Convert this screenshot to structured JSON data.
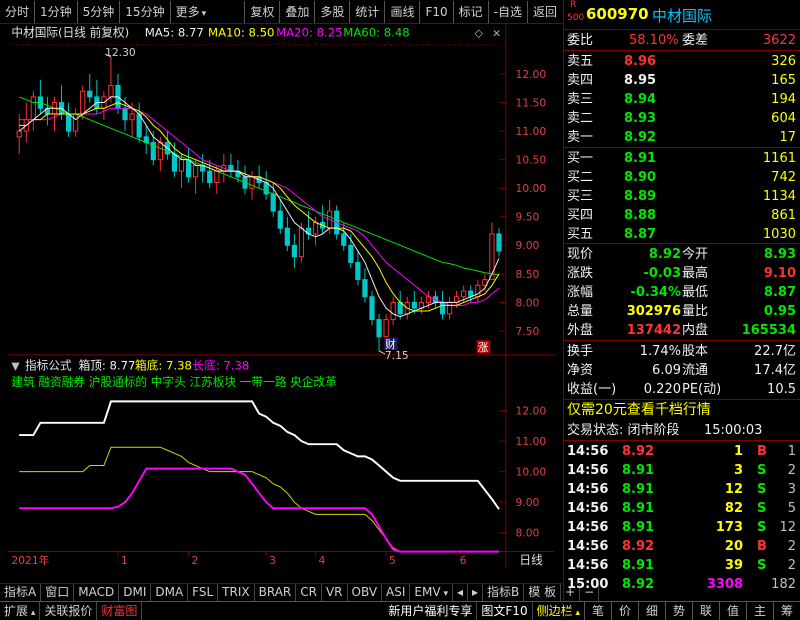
{
  "toolbar": {
    "left": [
      "分时",
      "1分钟",
      "5分钟",
      "15分钟",
      "更多"
    ],
    "right": [
      "复权",
      "叠加",
      "多股",
      "统计",
      "画线",
      "F10",
      "标记",
      "-自选",
      "返回"
    ]
  },
  "chart_header": {
    "title": "中材国际(日线 前复权)",
    "ma5": "MA5: 8.77",
    "ma10": "MA10: 8.50",
    "ma20": "MA20: 8.25",
    "ma60": "MA60: 8.48",
    "high_mark": "12.30",
    "low_mark": "7.15",
    "cai_label": "财",
    "zhang_label": "涨"
  },
  "indicator": {
    "title": "指标公式",
    "top": "箱顶: 8.77",
    "bottom": "箱底: 7.38",
    "long_bottom": "长底: 7.38",
    "concepts": "建筑 融资融券 沪股通标的 中字头 江苏板块 一带一路 央企改革"
  },
  "chart_data": [
    {
      "type": "candlestick",
      "title": "中材国际(日线 前复权)",
      "y_ticks": [
        "12.00",
        "11.50",
        "11.00",
        "10.50",
        "10.00",
        "9.50",
        "9.00",
        "8.50",
        "8.00",
        "7.50"
      ],
      "ylim": [
        7.15,
        12.45
      ],
      "x_ticks": [
        "2021年",
        "1",
        "2",
        "3",
        "4",
        "5",
        "6"
      ],
      "x_last": "日线",
      "series_names": [
        "MA5",
        "MA10",
        "MA20",
        "MA60"
      ],
      "candles": [
        [
          10.9,
          11.3,
          10.6,
          11.0
        ],
        [
          11.0,
          11.5,
          10.8,
          11.2
        ],
        [
          11.2,
          11.7,
          11.0,
          11.6
        ],
        [
          11.6,
          11.9,
          11.3,
          11.4
        ],
        [
          11.4,
          11.6,
          11.1,
          11.3
        ],
        [
          11.3,
          11.6,
          11.0,
          11.5
        ],
        [
          11.5,
          11.8,
          11.2,
          11.3
        ],
        [
          11.3,
          11.5,
          10.9,
          11.0
        ],
        [
          11.0,
          11.4,
          10.9,
          11.3
        ],
        [
          11.3,
          11.8,
          11.2,
          11.7
        ],
        [
          11.7,
          12.0,
          11.5,
          11.6
        ],
        [
          11.6,
          11.9,
          11.3,
          11.4
        ],
        [
          11.4,
          11.7,
          11.2,
          11.6
        ],
        [
          11.6,
          12.3,
          11.5,
          11.8
        ],
        [
          11.8,
          12.0,
          11.3,
          11.4
        ],
        [
          11.4,
          11.6,
          11.0,
          11.2
        ],
        [
          11.2,
          11.5,
          10.9,
          11.3
        ],
        [
          11.3,
          11.5,
          10.8,
          10.9
        ],
        [
          10.9,
          11.1,
          10.6,
          10.8
        ],
        [
          10.8,
          11.0,
          10.4,
          10.5
        ],
        [
          10.5,
          10.9,
          10.3,
          10.8
        ],
        [
          10.8,
          11.0,
          10.5,
          10.6
        ],
        [
          10.6,
          10.8,
          10.2,
          10.3
        ],
        [
          10.3,
          10.6,
          10.0,
          10.5
        ],
        [
          10.5,
          10.7,
          10.1,
          10.2
        ],
        [
          10.2,
          10.5,
          9.9,
          10.4
        ],
        [
          10.4,
          10.6,
          10.1,
          10.3
        ],
        [
          10.3,
          10.5,
          10.0,
          10.1
        ],
        [
          10.1,
          10.4,
          9.9,
          10.3
        ],
        [
          10.3,
          10.6,
          10.1,
          10.4
        ],
        [
          10.4,
          10.6,
          10.2,
          10.3
        ],
        [
          10.3,
          10.5,
          10.1,
          10.2
        ],
        [
          10.2,
          10.4,
          9.9,
          10.0
        ],
        [
          10.0,
          10.3,
          9.8,
          10.2
        ],
        [
          10.2,
          10.4,
          10.0,
          10.1
        ],
        [
          10.1,
          10.3,
          9.8,
          9.9
        ],
        [
          9.9,
          10.1,
          9.5,
          9.6
        ],
        [
          9.6,
          9.8,
          9.2,
          9.3
        ],
        [
          9.3,
          9.5,
          8.9,
          9.0
        ],
        [
          9.0,
          9.2,
          8.6,
          8.8
        ],
        [
          8.8,
          9.4,
          8.7,
          9.3
        ],
        [
          9.3,
          9.6,
          9.1,
          9.2
        ],
        [
          9.2,
          9.5,
          9.0,
          9.4
        ],
        [
          9.4,
          9.7,
          9.2,
          9.3
        ],
        [
          9.3,
          9.8,
          9.2,
          9.6
        ],
        [
          9.6,
          9.7,
          9.1,
          9.2
        ],
        [
          9.2,
          9.4,
          8.9,
          9.0
        ],
        [
          9.0,
          9.2,
          8.6,
          8.7
        ],
        [
          8.7,
          8.9,
          8.3,
          8.4
        ],
        [
          8.4,
          8.6,
          8.0,
          8.1
        ],
        [
          8.1,
          8.2,
          7.6,
          7.7
        ],
        [
          7.7,
          7.8,
          7.15,
          7.4
        ],
        [
          7.4,
          7.8,
          7.3,
          7.7
        ],
        [
          7.7,
          8.1,
          7.6,
          8.0
        ],
        [
          8.0,
          8.2,
          7.7,
          7.8
        ],
        [
          7.8,
          8.1,
          7.7,
          8.0
        ],
        [
          8.0,
          8.2,
          7.8,
          7.9
        ],
        [
          7.9,
          8.1,
          7.8,
          8.0
        ],
        [
          8.0,
          8.2,
          7.9,
          8.1
        ],
        [
          8.1,
          8.2,
          7.9,
          8.0
        ],
        [
          8.0,
          8.2,
          7.7,
          7.8
        ],
        [
          7.8,
          8.1,
          7.7,
          8.0
        ],
        [
          8.0,
          8.2,
          7.9,
          8.1
        ],
        [
          8.1,
          8.3,
          8.0,
          8.2
        ],
        [
          8.2,
          8.3,
          8.0,
          8.1
        ],
        [
          8.1,
          8.4,
          8.0,
          8.3
        ],
        [
          8.3,
          8.5,
          8.2,
          8.4
        ],
        [
          8.4,
          9.4,
          8.4,
          9.2
        ],
        [
          9.2,
          9.3,
          8.8,
          8.9
        ]
      ],
      "ma5": [
        11.0,
        11.1,
        11.2,
        11.3,
        11.4,
        11.4,
        11.4,
        11.3,
        11.2,
        11.3,
        11.4,
        11.5,
        11.5,
        11.6,
        11.6,
        11.5,
        11.4,
        11.3,
        11.1,
        10.9,
        10.8,
        10.7,
        10.6,
        10.5,
        10.5,
        10.4,
        10.4,
        10.35,
        10.3,
        10.3,
        10.3,
        10.3,
        10.2,
        10.2,
        10.15,
        10.1,
        10.0,
        9.8,
        9.6,
        9.4,
        9.3,
        9.2,
        9.15,
        9.2,
        9.3,
        9.3,
        9.25,
        9.1,
        8.9,
        8.7,
        8.4,
        8.1,
        7.9,
        7.8,
        7.75,
        7.8,
        7.85,
        7.9,
        7.95,
        8.0,
        8.0,
        8.0,
        8.0,
        8.05,
        8.1,
        8.15,
        8.25,
        8.5,
        8.77
      ],
      "ma10": [
        11.1,
        11.1,
        11.2,
        11.2,
        11.3,
        11.3,
        11.3,
        11.3,
        11.3,
        11.3,
        11.35,
        11.4,
        11.4,
        11.45,
        11.5,
        11.45,
        11.4,
        11.35,
        11.25,
        11.1,
        11.0,
        10.85,
        10.7,
        10.6,
        10.55,
        10.5,
        10.45,
        10.4,
        10.35,
        10.3,
        10.3,
        10.3,
        10.25,
        10.2,
        10.2,
        10.15,
        10.1,
        10.0,
        9.85,
        9.7,
        9.6,
        9.5,
        9.4,
        9.35,
        9.3,
        9.3,
        9.3,
        9.25,
        9.1,
        8.95,
        8.8,
        8.6,
        8.35,
        8.15,
        8.0,
        7.9,
        7.85,
        7.85,
        7.85,
        7.9,
        7.95,
        7.95,
        7.95,
        8.0,
        8.05,
        8.1,
        8.15,
        8.3,
        8.5
      ],
      "ma20": [
        11.2,
        11.2,
        11.2,
        11.2,
        11.2,
        11.25,
        11.3,
        11.3,
        11.3,
        11.3,
        11.3,
        11.3,
        11.35,
        11.4,
        11.4,
        11.4,
        11.4,
        11.35,
        11.3,
        11.2,
        11.1,
        11.0,
        10.9,
        10.8,
        10.7,
        10.6,
        10.5,
        10.45,
        10.4,
        10.35,
        10.3,
        10.3,
        10.25,
        10.2,
        10.2,
        10.15,
        10.1,
        10.05,
        10.0,
        9.9,
        9.8,
        9.7,
        9.6,
        9.5,
        9.45,
        9.4,
        9.35,
        9.3,
        9.25,
        9.15,
        9.0,
        8.85,
        8.7,
        8.6,
        8.5,
        8.4,
        8.3,
        8.2,
        8.1,
        8.05,
        8.0,
        7.95,
        7.95,
        7.95,
        8.0,
        8.0,
        8.05,
        8.15,
        8.25
      ],
      "ma60": [
        11.6,
        11.55,
        11.5,
        11.5,
        11.45,
        11.4,
        11.35,
        11.3,
        11.3,
        11.25,
        11.2,
        11.15,
        11.1,
        11.05,
        11.0,
        10.95,
        10.9,
        10.85,
        10.8,
        10.75,
        10.7,
        10.65,
        10.6,
        10.55,
        10.5,
        10.45,
        10.4,
        10.35,
        10.3,
        10.25,
        10.2,
        10.15,
        10.1,
        10.05,
        10.0,
        9.95,
        9.9,
        9.85,
        9.8,
        9.75,
        9.7,
        9.65,
        9.6,
        9.55,
        9.5,
        9.45,
        9.4,
        9.35,
        9.3,
        9.25,
        9.2,
        9.15,
        9.1,
        9.05,
        9.0,
        8.95,
        8.9,
        8.85,
        8.8,
        8.75,
        8.7,
        8.68,
        8.65,
        8.6,
        8.58,
        8.55,
        8.52,
        8.5,
        8.48
      ]
    },
    {
      "type": "line",
      "title": "指标公式",
      "y_ticks": [
        "12.00",
        "11.00",
        "10.00",
        "9.00",
        "8.00"
      ],
      "ylim": [
        7.45,
        12.55
      ],
      "series": [
        {
          "name": "箱顶",
          "values": [
            11.2,
            11.2,
            11.2,
            11.6,
            11.6,
            11.6,
            11.6,
            11.6,
            11.6,
            11.6,
            11.6,
            11.6,
            11.6,
            12.3,
            12.3,
            12.3,
            12.3,
            12.3,
            12.3,
            12.3,
            12.3,
            12.3,
            12.3,
            12.3,
            12.3,
            12.3,
            12.3,
            12.3,
            12.3,
            12.3,
            12.3,
            12.3,
            12.3,
            12.3,
            11.9,
            11.8,
            11.6,
            11.5,
            11.3,
            11.2,
            11.0,
            10.9,
            10.9,
            10.9,
            10.9,
            10.9,
            10.7,
            10.6,
            10.5,
            10.5,
            10.4,
            10.2,
            10.0,
            9.8,
            9.7,
            9.7,
            9.7,
            9.7,
            9.7,
            9.7,
            9.7,
            9.7,
            9.7,
            9.7,
            9.7,
            9.7,
            9.4,
            9.1,
            8.77
          ]
        },
        {
          "name": "箱底",
          "values": [
            10.0,
            10.0,
            10.0,
            10.0,
            10.0,
            10.0,
            10.0,
            10.0,
            10.0,
            10.0,
            10.2,
            10.2,
            10.2,
            10.8,
            10.8,
            10.8,
            10.8,
            10.8,
            10.8,
            10.8,
            10.8,
            10.7,
            10.6,
            10.5,
            10.3,
            10.2,
            10.1,
            10.0,
            10.0,
            10.0,
            10.0,
            10.0,
            10.0,
            10.0,
            9.9,
            9.8,
            9.6,
            9.5,
            9.3,
            9.0,
            8.8,
            8.7,
            8.6,
            8.6,
            8.6,
            8.6,
            8.6,
            8.6,
            8.6,
            8.6,
            8.4,
            8.1,
            7.8,
            7.5,
            7.38,
            7.38,
            7.38,
            7.38,
            7.38,
            7.38,
            7.38,
            7.38,
            7.38,
            7.38,
            7.38,
            7.38,
            7.38,
            7.38,
            7.38
          ]
        },
        {
          "name": "长底",
          "values": [
            8.8,
            8.8,
            8.8,
            8.8,
            8.8,
            8.8,
            8.8,
            8.8,
            8.8,
            8.8,
            8.8,
            8.8,
            8.8,
            8.8,
            8.85,
            9.0,
            9.3,
            9.7,
            10.1,
            10.1,
            10.1,
            10.1,
            10.1,
            10.1,
            10.1,
            10.1,
            10.1,
            10.1,
            10.1,
            10.1,
            10.1,
            10.0,
            9.9,
            9.6,
            9.3,
            9.0,
            8.8,
            8.8,
            8.8,
            8.8,
            8.8,
            8.8,
            8.8,
            8.8,
            8.8,
            8.8,
            8.8,
            8.8,
            8.8,
            8.8,
            8.6,
            8.2,
            7.8,
            7.45,
            7.38,
            7.38,
            7.38,
            7.38,
            7.38,
            7.38,
            7.38,
            7.38,
            7.38,
            7.38,
            7.38,
            7.38,
            7.38,
            7.38,
            7.38
          ]
        }
      ]
    }
  ],
  "quote": {
    "r_label": "R",
    "code_prefix": "500",
    "code": "600970",
    "name": "中材国际",
    "webi_label": "委比",
    "webi": "58.10%",
    "weicha_label": "委差",
    "weicha": "3622",
    "asks": [
      {
        "label": "卖五",
        "price": "8.96",
        "vol": "326",
        "color": "#ff3232"
      },
      {
        "label": "卖四",
        "price": "8.95",
        "vol": "165",
        "color": "#f0f0f0"
      },
      {
        "label": "卖三",
        "price": "8.94",
        "vol": "194",
        "color": "#00e600"
      },
      {
        "label": "卖二",
        "price": "8.93",
        "vol": "604",
        "color": "#00e600"
      },
      {
        "label": "卖一",
        "price": "8.92",
        "vol": "17",
        "color": "#00e600"
      }
    ],
    "bids": [
      {
        "label": "买一",
        "price": "8.91",
        "vol": "1161",
        "color": "#00e600"
      },
      {
        "label": "买二",
        "price": "8.90",
        "vol": "742",
        "color": "#00e600"
      },
      {
        "label": "买三",
        "price": "8.89",
        "vol": "1134",
        "color": "#00e600"
      },
      {
        "label": "买四",
        "price": "8.88",
        "vol": "861",
        "color": "#00e600"
      },
      {
        "label": "买五",
        "price": "8.87",
        "vol": "1030",
        "color": "#00e600"
      }
    ],
    "stats": [
      {
        "l1": "现价",
        "v1": "8.92",
        "c1": "#00e600",
        "l2": "今开",
        "v2": "8.93",
        "c2": "#00e600"
      },
      {
        "l1": "涨跌",
        "v1": "-0.03",
        "c1": "#00e600",
        "l2": "最高",
        "v2": "9.10",
        "c2": "#ff3232"
      },
      {
        "l1": "涨幅",
        "v1": "-0.34%",
        "c1": "#00e600",
        "l2": "最低",
        "v2": "8.87",
        "c2": "#00e600"
      },
      {
        "l1": "总量",
        "v1": "302976",
        "c1": "#ffff00",
        "l2": "量比",
        "v2": "0.95",
        "c2": "#00e600"
      },
      {
        "l1": "外盘",
        "v1": "137442",
        "c1": "#ff3232",
        "l2": "内盘",
        "v2": "165534",
        "c2": "#00e600"
      }
    ],
    "fin": [
      {
        "l1": "换手",
        "v1": "1.74%",
        "l2": "股本",
        "v2": "22.7亿"
      },
      {
        "l1": "净资",
        "v1": "6.09",
        "l2": "流通",
        "v2": "17.4亿"
      },
      {
        "l1": "收益(一)",
        "v1": "0.220",
        "l2": "PE(动)",
        "v2": "10.5"
      }
    ],
    "promo": "仅需20元查看千档行情",
    "status_label": "交易状态: 闭市阶段",
    "status_time": "15:00:03",
    "ticks": [
      {
        "t": "14:56",
        "p": "8.92",
        "pc": "#ff3232",
        "v": "1",
        "vc": "#ffff00",
        "d": "B",
        "dc": "#ff3232",
        "n": "1"
      },
      {
        "t": "14:56",
        "p": "8.91",
        "pc": "#00e600",
        "v": "3",
        "vc": "#ffff00",
        "d": "S",
        "dc": "#00e600",
        "n": "2"
      },
      {
        "t": "14:56",
        "p": "8.91",
        "pc": "#00e600",
        "v": "12",
        "vc": "#ffff00",
        "d": "S",
        "dc": "#00e600",
        "n": "3"
      },
      {
        "t": "14:56",
        "p": "8.91",
        "pc": "#00e600",
        "v": "82",
        "vc": "#ffff00",
        "d": "S",
        "dc": "#00e600",
        "n": "5"
      },
      {
        "t": "14:56",
        "p": "8.91",
        "pc": "#00e600",
        "v": "173",
        "vc": "#ffff00",
        "d": "S",
        "dc": "#00e600",
        "n": "12"
      },
      {
        "t": "14:56",
        "p": "8.92",
        "pc": "#ff3232",
        "v": "20",
        "vc": "#ffff00",
        "d": "B",
        "dc": "#ff3232",
        "n": "2"
      },
      {
        "t": "14:56",
        "p": "8.91",
        "pc": "#00e600",
        "v": "39",
        "vc": "#ffff00",
        "d": "S",
        "dc": "#00e600",
        "n": "2"
      },
      {
        "t": "15:00",
        "p": "8.92",
        "pc": "#00e600",
        "v": "3308",
        "vc": "#ff00ff",
        "d": "",
        "dc": "#c0c0c0",
        "n": "182"
      }
    ]
  },
  "bottom_bar": {
    "tabs": [
      "指标A",
      "窗口",
      "MACD",
      "DMI",
      "DMA",
      "FSL",
      "TRIX",
      "BRAR",
      "CR",
      "VR",
      "OBV",
      "ASI",
      "EMV"
    ],
    "right": [
      "指标B",
      "模 板",
      "+",
      "−"
    ]
  },
  "status_bar": {
    "left": [
      "扩展",
      "关联报价",
      "财富图"
    ],
    "promo": "新用户福利专享",
    "f10": "图文F10",
    "sidebar": "侧边栏",
    "nav": [
      "笔",
      "价",
      "细",
      "势",
      "联",
      "值",
      "主",
      "筹"
    ]
  },
  "colors": {
    "up": "#ff3232",
    "down": "#00c8c8",
    "ma5": "#f0f0f0",
    "ma10": "#ffff00",
    "ma20": "#ff00ff",
    "ma60": "#00e600",
    "panel_border": "#800000"
  }
}
